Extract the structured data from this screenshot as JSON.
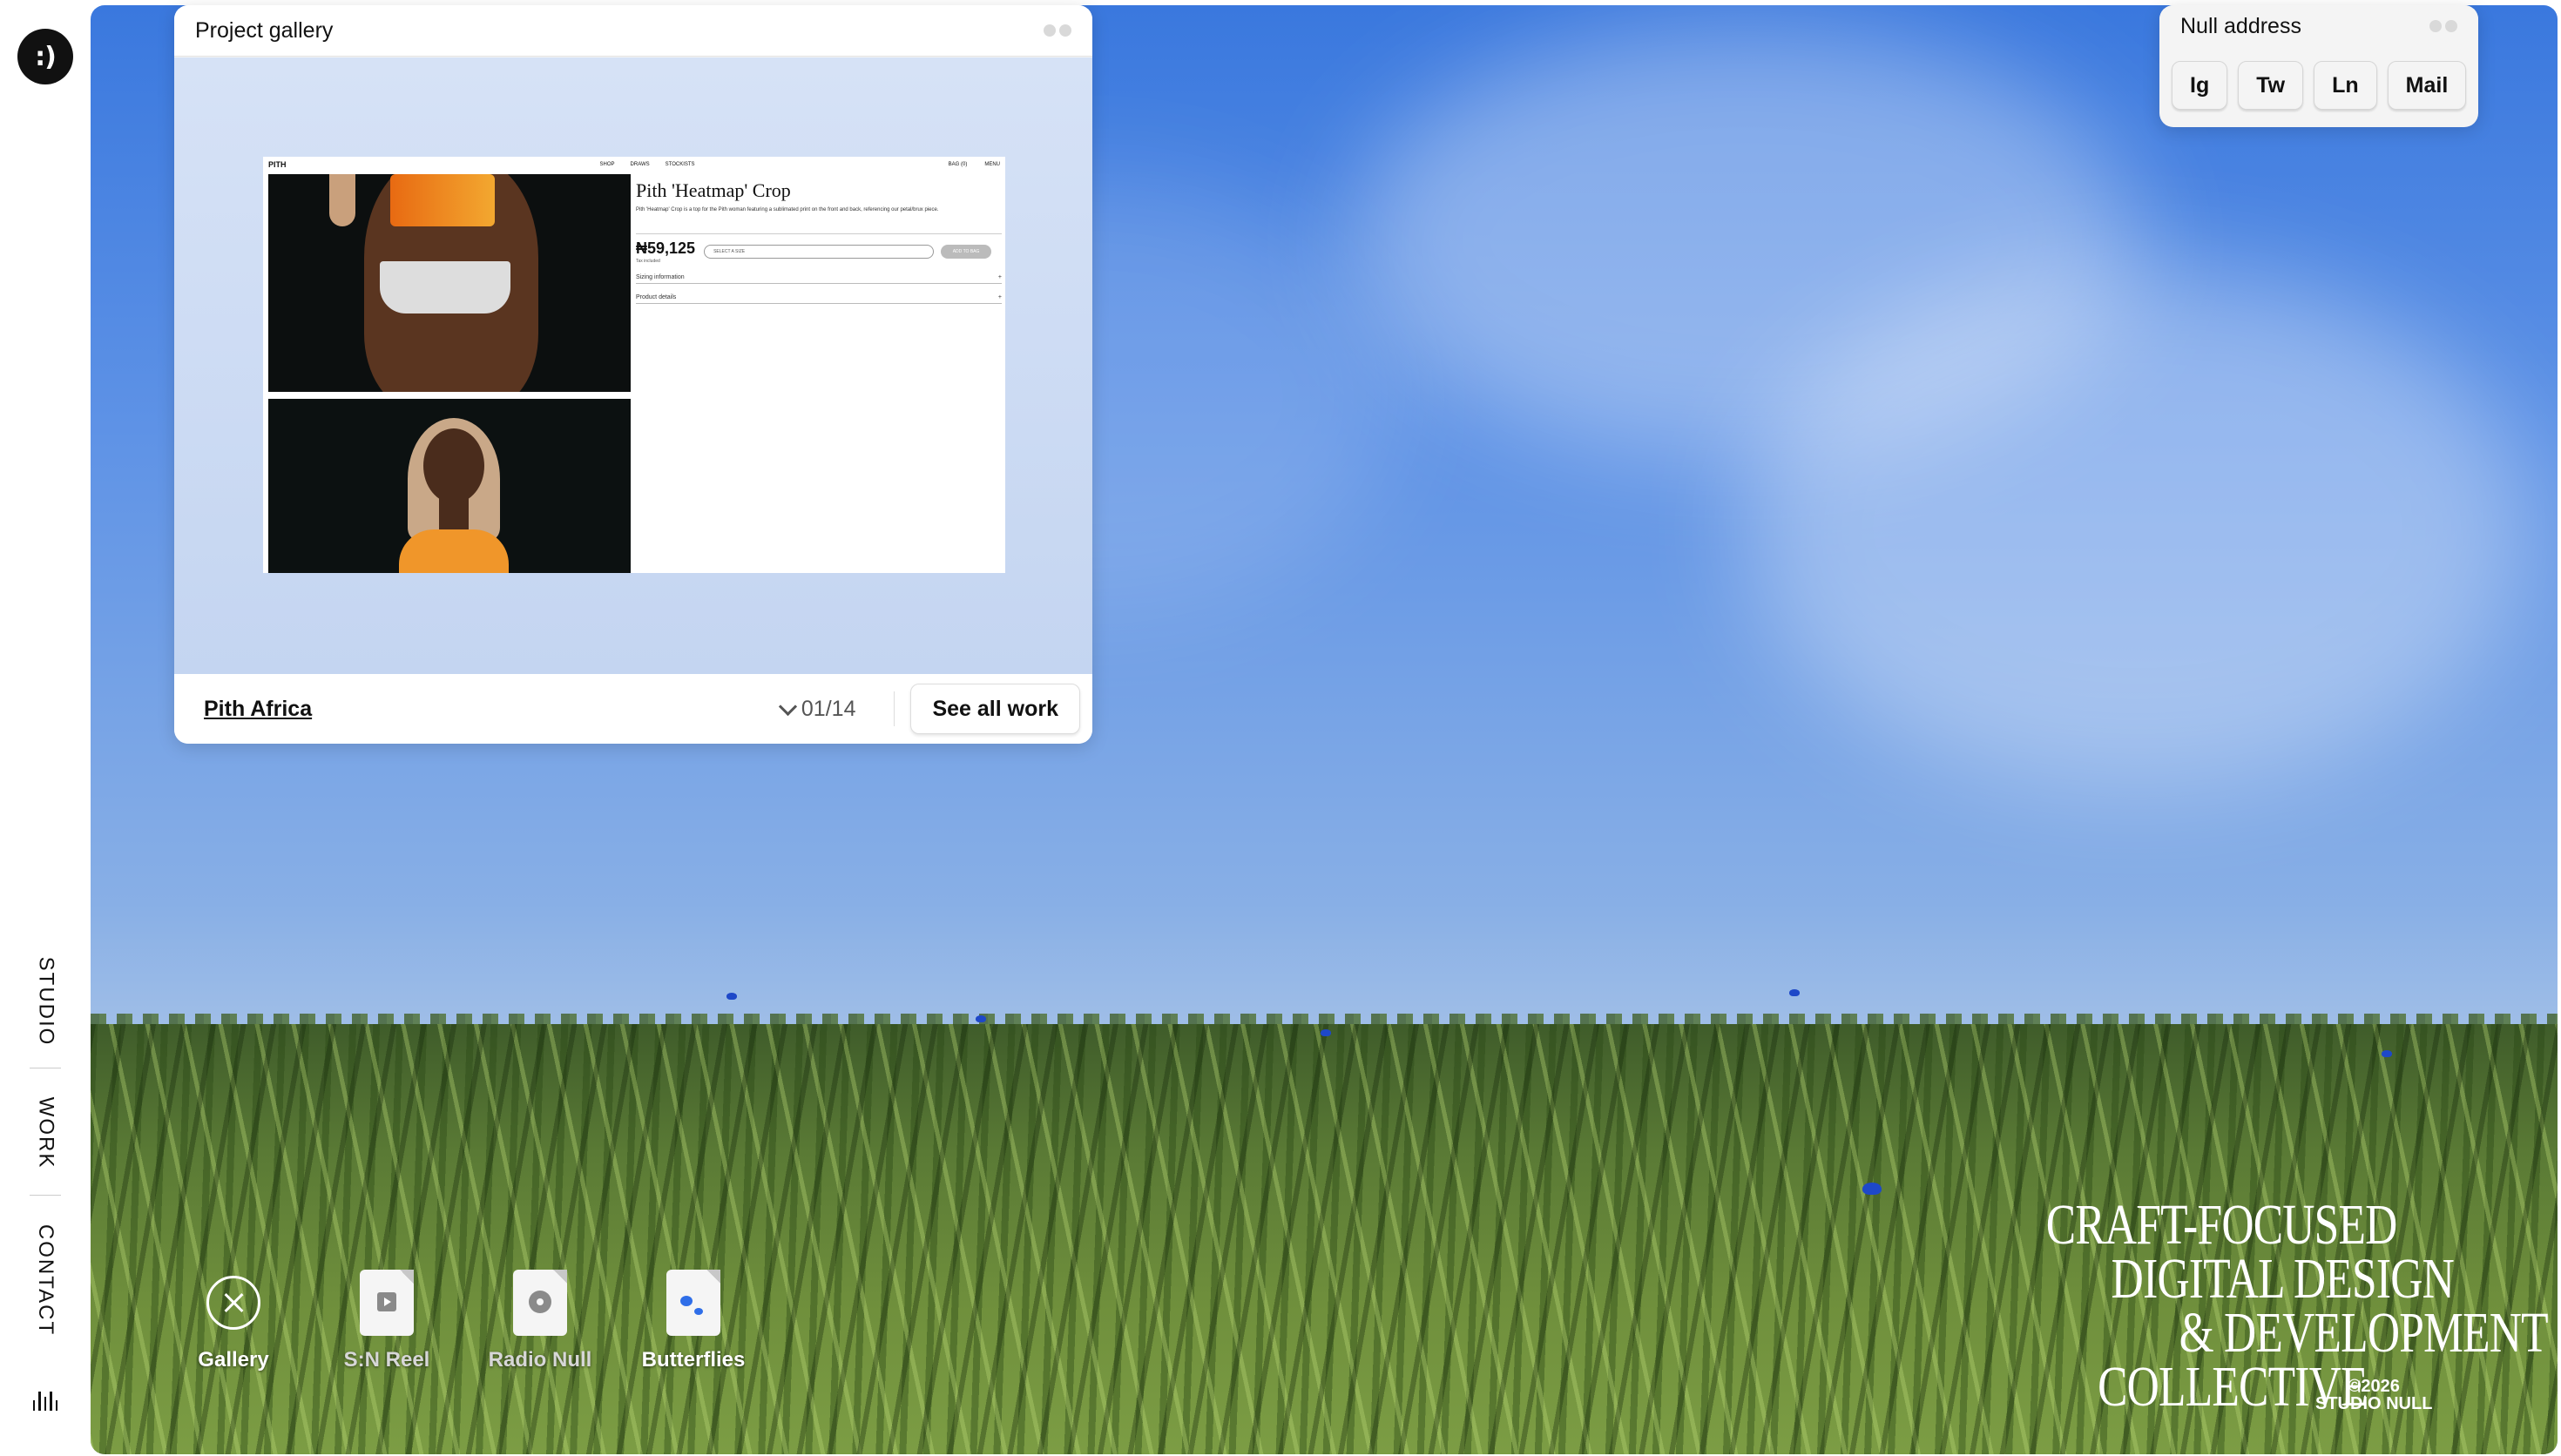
{
  "logo": {
    "text": ":)"
  },
  "nav": {
    "items": [
      {
        "label": "STUDIO"
      },
      {
        "label": "WORK"
      },
      {
        "label": "CONTACT"
      }
    ],
    "sound_icon": "equalizer-icon"
  },
  "gallery_window": {
    "title": "Project gallery",
    "project_name": "Pith Africa",
    "counter": "01/14",
    "see_all_label": "See all work",
    "preview": {
      "brand": "PITH",
      "nav": [
        "SHOP",
        "DRAWS",
        "STOCKISTS"
      ],
      "right_nav": [
        "BAG (0)",
        "MENU"
      ],
      "product_title": "Pith 'Heatmap' Crop",
      "product_desc": "Pith 'Heatmap' Crop is a top for the Pith woman featuring a sublimated print on the front and back, referencing our petal/brux piece.",
      "price": "₦59,125",
      "tax_note": "Tax included",
      "select_placeholder": "SELECT A SIZE",
      "add_label": "ADD TO BAG",
      "accordions": [
        "Sizing information",
        "Product details"
      ]
    }
  },
  "contact_window": {
    "title": "Null address",
    "buttons": [
      {
        "label": "Ig"
      },
      {
        "label": "Tw"
      },
      {
        "label": "Ln"
      },
      {
        "label": "Mail"
      }
    ]
  },
  "desktop_icons": [
    {
      "label": "Gallery",
      "icon": "close-circle-icon"
    },
    {
      "label": "S:N Reel",
      "icon": "video-file-icon"
    },
    {
      "label": "Radio Null",
      "icon": "audio-file-icon"
    },
    {
      "label": "Butterflies",
      "icon": "butterflies-file-icon"
    }
  ],
  "tagline": {
    "lines": [
      "Craft-focused",
      "digital design",
      "& development",
      "collective"
    ]
  },
  "copyright": {
    "year": "©2026",
    "name": "STUDIO NULL"
  },
  "colors": {
    "sky_top": "#3a78de",
    "sky_bottom": "#a9c4e8",
    "grass": "#5a7a35",
    "butterfly": "#1e48c8"
  }
}
